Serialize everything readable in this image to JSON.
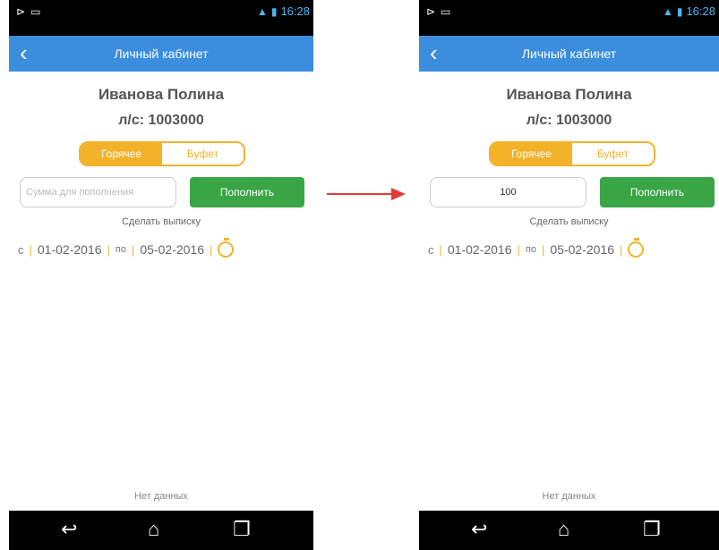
{
  "status_time": "16:28",
  "app_title": "Личный кабинет",
  "user_name": "Иванова Полина",
  "account": "л/с: 1003000",
  "tabs": [
    "Горячее",
    "Буфет"
  ],
  "amount_placeholder": "Сумма для пополнения",
  "amount_value": "100",
  "topup_label": "Пополнить",
  "statement_label": "Сделать выписку",
  "date_from_prefix": "с",
  "date_from": "01-02-2016",
  "date_to_prefix": "по",
  "date_to": "05-02-2016",
  "no_data": "Нет данных",
  "colors": {
    "appbar": "#3b8ede",
    "accent": "#f2b32b",
    "button": "#3aa545",
    "arrow": "#e53935"
  },
  "icons": [
    "back-arrow-icon",
    "clock-icon",
    "back-nav-icon",
    "home-nav-icon",
    "recents-nav-icon",
    "signal-icon",
    "battery-icon"
  ]
}
